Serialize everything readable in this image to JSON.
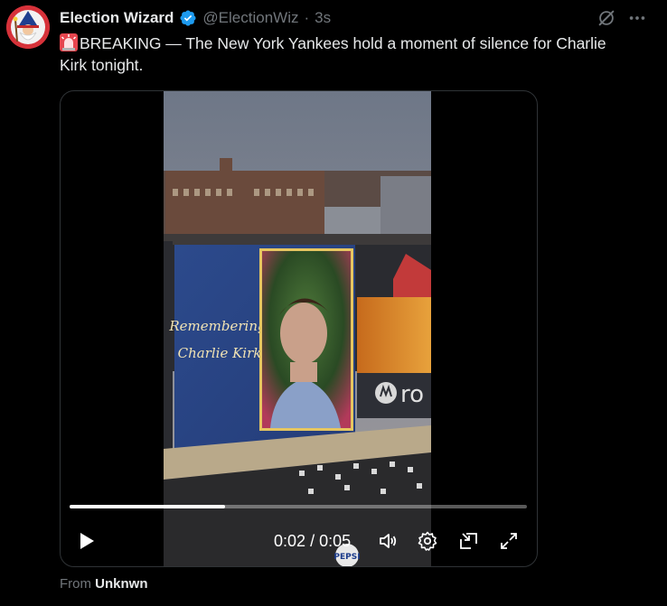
{
  "tweet": {
    "display_name": "Election Wizard",
    "handle": "@ElectionWiz",
    "separator": "·",
    "time": "3s",
    "body": "BREAKING — The New York Yankees hold a moment of silence for Charlie Kirk tonight.",
    "source_prefix": "From",
    "source_name": "Unknwn"
  },
  "video": {
    "current_time": "0:02",
    "duration": "0:05",
    "time_separator": "/",
    "progress": 0.34,
    "scoreboard_text_line1": "Remembering",
    "scoreboard_text_line2": "Charlie Kirk",
    "sign_text": "ro",
    "stand_text": "PEPSI"
  },
  "icons": {
    "verified": "verified-badge-icon",
    "grok": "grok-icon",
    "more": "more-options-icon",
    "siren": "police-light-emoji",
    "play": "play-icon",
    "volume": "volume-icon",
    "settings": "settings-gear-icon",
    "dock": "dock-video-icon",
    "fullscreen": "fullscreen-icon"
  },
  "colors": {
    "background": "#000000",
    "text_primary": "#e7e9ea",
    "text_secondary": "#71767b",
    "verified": "#1d9bf0",
    "avatar_bg": "#d7323a"
  }
}
